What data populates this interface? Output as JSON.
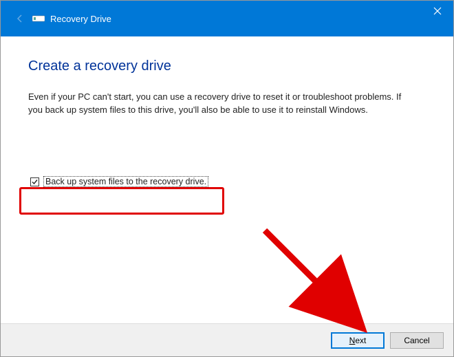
{
  "titlebar": {
    "title": "Recovery Drive"
  },
  "content": {
    "heading": "Create a recovery drive",
    "description": "Even if your PC can't start, you can use a recovery drive to reset it or troubleshoot problems. If you back up system files to this drive, you'll also be able to use it to reinstall Windows."
  },
  "checkbox": {
    "checked": true,
    "label": "Back up system files to the recovery drive."
  },
  "footer": {
    "next_label": "Next",
    "cancel_label": "Cancel"
  },
  "annotations": {
    "highlight_color": "#e00000",
    "arrow_color": "#e00000"
  }
}
